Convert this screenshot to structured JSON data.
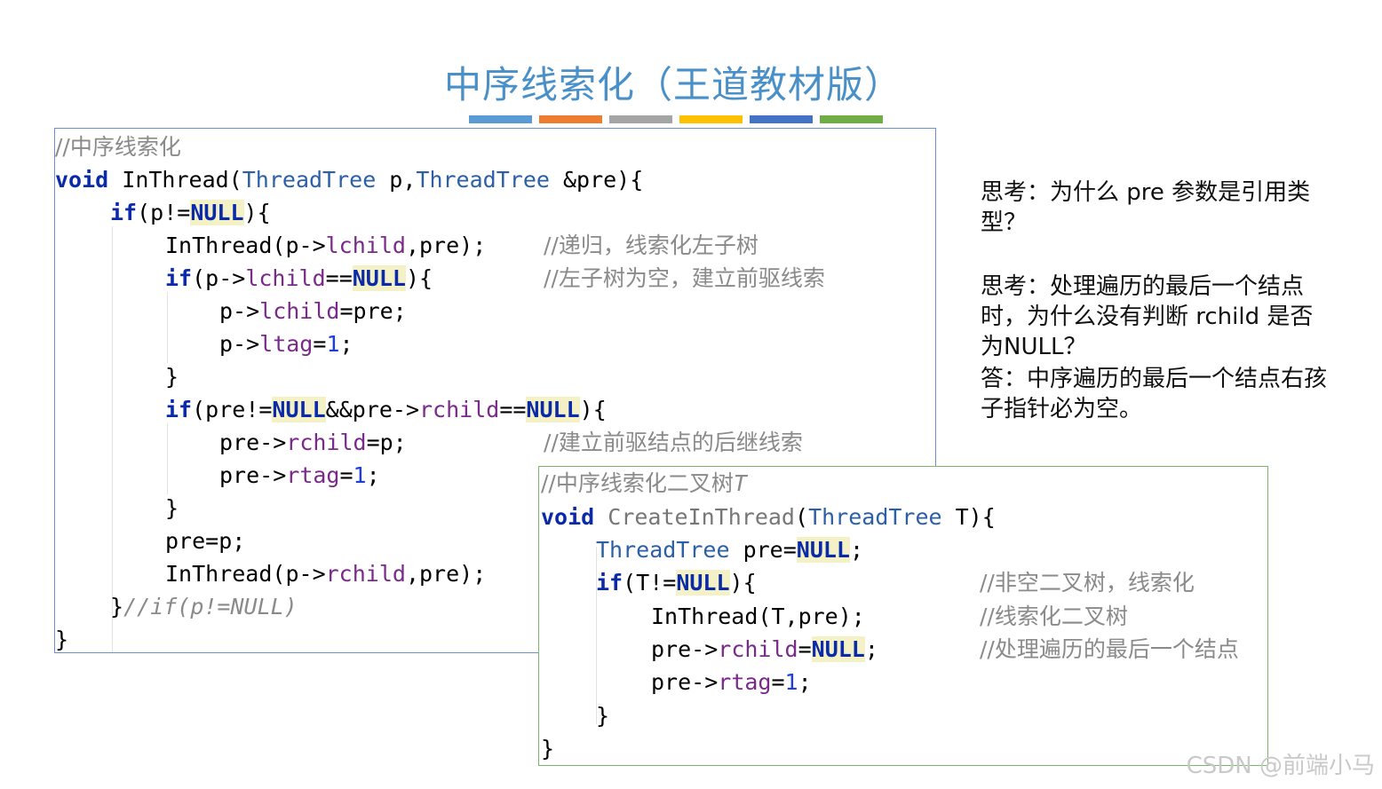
{
  "title": "中序线索化（王道教材版）",
  "colors": {
    "bars": [
      "#5b9bd5",
      "#ed7d31",
      "#a5a5a5",
      "#ffc000",
      "#4472c4",
      "#70ad47"
    ],
    "box1_border": "#6b8fd1",
    "box2_border": "#7cb66c"
  },
  "code1": {
    "l1": "//中序线索化",
    "l2_kw": "void",
    "l2_fn": " InThread(",
    "l2_t1": "ThreadTree",
    "l2_p1": " p,",
    "l2_t2": "ThreadTree",
    "l2_p2": " &pre){",
    "l3_kw": "if",
    "l3_a": "(p!=",
    "l3_null": "NULL",
    "l3_b": "){",
    "l4_a": "InThread(p->",
    "l4_f": "lchild",
    "l4_b": ",pre);",
    "l4_c": "//递归，线索化左子树",
    "l5_kw": "if",
    "l5_a": "(p->",
    "l5_f": "lchild",
    "l5_b": "==",
    "l5_null": "NULL",
    "l5_c": "){",
    "l5_cmt": "//左子树为空，建立前驱线索",
    "l6_a": "p->",
    "l6_f": "lchild",
    "l6_b": "=pre;",
    "l7_a": "p->",
    "l7_f": "ltag",
    "l7_b": "=",
    "l7_n": "1",
    "l7_c": ";",
    "l8": "}",
    "l9_kw": "if",
    "l9_a": "(pre!=",
    "l9_null1": "NULL",
    "l9_b": "&&pre->",
    "l9_f": "rchild",
    "l9_c": "==",
    "l9_null2": "NULL",
    "l9_d": "){",
    "l10_a": "pre->",
    "l10_f": "rchild",
    "l10_b": "=p;",
    "l10_cmt": "//建立前驱结点的后继线索",
    "l11_a": "pre->",
    "l11_f": "rtag",
    "l11_b": "=",
    "l11_n": "1",
    "l11_c": ";",
    "l12": "}",
    "l13": "pre=p;",
    "l14_a": "InThread(p->",
    "l14_f": "rchild",
    "l14_b": ",pre);",
    "l15_a": "}",
    "l15_cmt": "//if(p!=NULL)",
    "l16": "}"
  },
  "code2": {
    "l1_a": "//中序线索化二叉树",
    "l1_b": "T",
    "l2_kw": "void",
    "l2_fn": " CreateInThread",
    "l2_a": "(",
    "l2_t": "ThreadTree",
    "l2_b": " T){",
    "l3_t": "ThreadTree",
    "l3_a": " pre=",
    "l3_null": "NULL",
    "l3_b": ";",
    "l4_kw": "if",
    "l4_a": "(T!=",
    "l4_null": "NULL",
    "l4_b": "){",
    "l4_cmt": "//非空二叉树，线索化",
    "l5": "InThread(T,pre);",
    "l5_cmt": "//线索化二叉树",
    "l6_a": "pre->",
    "l6_f": "rchild",
    "l6_b": "=",
    "l6_null": "NULL",
    "l6_c": ";",
    "l6_cmt": "//处理遍历的最后一个结点",
    "l7_a": "pre->",
    "l7_f": "rtag",
    "l7_b": "=",
    "l7_n": "1",
    "l7_c": ";",
    "l8": "}",
    "l9": "}"
  },
  "notes": {
    "q1": "思考：为什么 pre 参数是引用类型？",
    "q2": "思考：处理遍历的最后一个结点时，为什么没有判断 rchild 是否为NULL？",
    "a2": "答：中序遍历的最后一个结点右孩子指针必为空。"
  },
  "watermark": "CSDN @前端小马"
}
